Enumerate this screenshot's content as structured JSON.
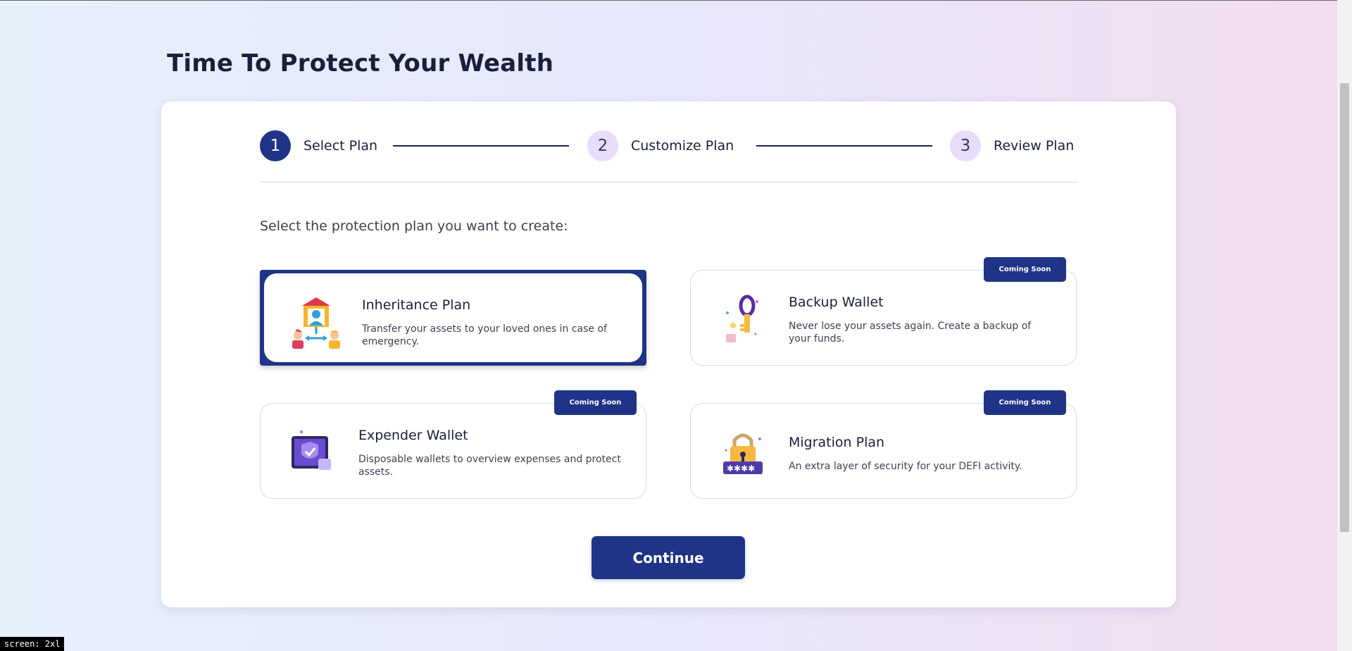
{
  "page": {
    "title": "Time To Protect Your Wealth"
  },
  "stepper": {
    "steps": [
      {
        "number": "1",
        "label": "Select Plan",
        "state": "active"
      },
      {
        "number": "2",
        "label": "Customize Plan",
        "state": "idle"
      },
      {
        "number": "3",
        "label": "Review Plan",
        "state": "idle"
      }
    ]
  },
  "instruction": "Select the protection plan you want to create:",
  "plans": [
    {
      "title": "Inheritance Plan",
      "description": "Transfer your assets to your loved ones in case of emergency.",
      "selected": true,
      "badge": "",
      "icon": "inheritance-icon"
    },
    {
      "title": "Backup Wallet",
      "description": "Never lose your assets again. Create a backup of your funds.",
      "selected": false,
      "badge": "Coming Soon",
      "icon": "backup-key-icon"
    },
    {
      "title": "Expender Wallet",
      "description": "Disposable wallets to overview expenses and protect assets.",
      "selected": false,
      "badge": "Coming Soon",
      "icon": "expender-shield-icon"
    },
    {
      "title": "Migration Plan",
      "description": "An extra layer of security for your DEFI activity.",
      "selected": false,
      "badge": "Coming Soon",
      "icon": "lock-password-icon"
    }
  ],
  "continue_label": "Continue",
  "screen_tag": "screen: 2xl",
  "colors": {
    "primary": "#1f3487",
    "step_idle": "#e7dcf9",
    "text": "#1b1f3b"
  }
}
